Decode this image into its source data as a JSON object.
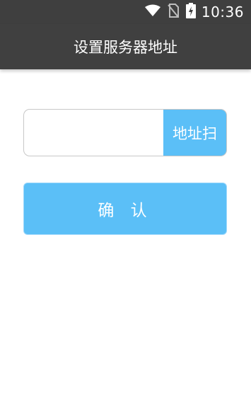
{
  "status_bar": {
    "time": "10:36",
    "icons": [
      "wifi-icon",
      "no-sim-icon",
      "battery-charging-icon"
    ]
  },
  "header": {
    "title": "设置服务器地址"
  },
  "form": {
    "server_address_value": "",
    "server_address_placeholder": "",
    "scan_button_label": "地址扫",
    "confirm_button_label": "确 认"
  },
  "colors": {
    "accent": "#5bbff7",
    "header_bg": "#404040",
    "status_bg": "#3f3f3f"
  }
}
